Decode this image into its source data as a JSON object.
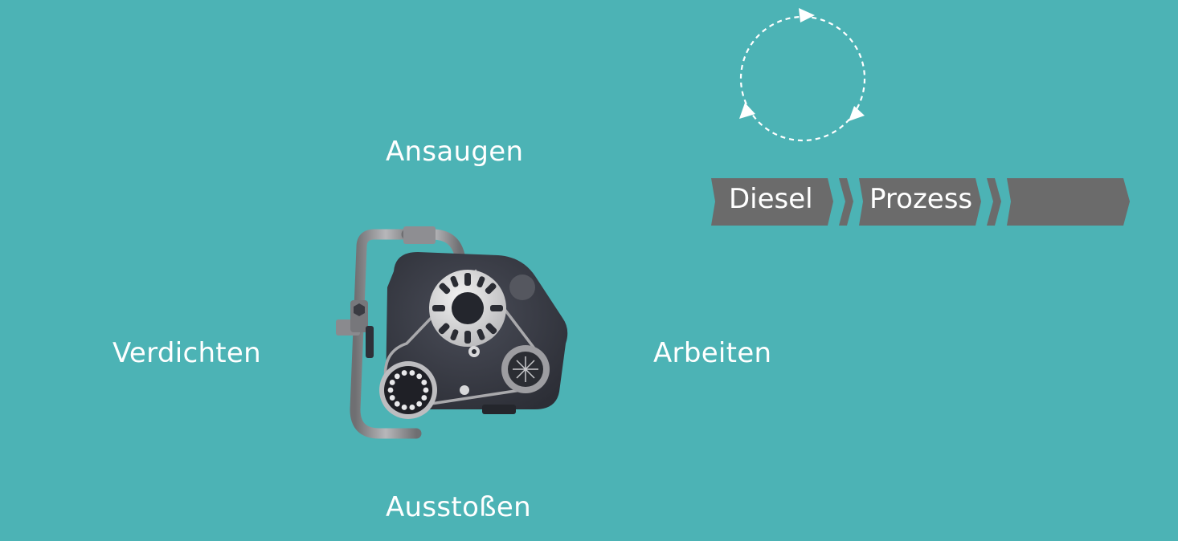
{
  "strokes": {
    "top": "Ansaugen",
    "left": "Verdichten",
    "right": "Arbeiten",
    "bottom": "Ausstoßen"
  },
  "process_steps": [
    {
      "label": "Diesel"
    },
    {
      "label": "Prozess"
    },
    {
      "label": ""
    }
  ],
  "colors": {
    "background": "#4cb3b5",
    "chevron": "#6b6b6b",
    "text": "#ffffff"
  },
  "icons": {
    "cycle": "cycle-arrows-icon",
    "engine": "wankel-engine-illustration"
  }
}
